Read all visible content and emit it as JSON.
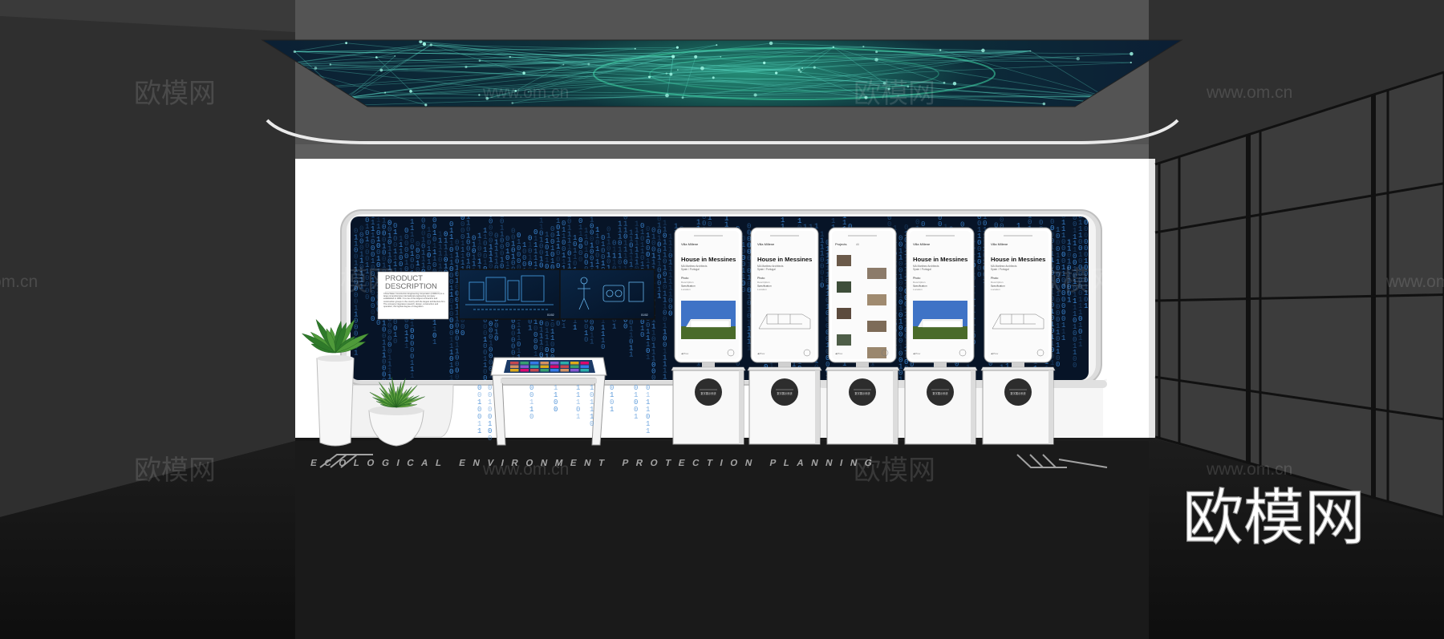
{
  "watermarks": {
    "brand_cn": "欧模网",
    "site": "www.om.cn",
    "site_partial": "om.cn",
    "big_logo": "欧模网"
  },
  "description_panel": {
    "title_line1": "PRODUCT",
    "title_line2": "DESCRIPTION",
    "body": "China Water Construction Engineering Corporation (CWECC) is a large comprehensive international engineering company established in 1982. It is one of the largest contractors and construction groups in the country with the largest architecture firm. The company integrates research, design, construction and operation, the highest degree of integration."
  },
  "screen_panels": {
    "left_caption": "01/02",
    "right_caption": "01/02"
  },
  "kiosks": [
    {
      "type": "house",
      "header": "Villa Millene",
      "title": "House in Messines",
      "sub1": "MA Martinez Architects",
      "sub2": "Spain / Portugal",
      "section": "Photo",
      "items": [
        "Description",
        "Specification",
        "Location"
      ],
      "footer_left": "◀ Prev",
      "footer_right": "Next ▶"
    },
    {
      "type": "house-sketch",
      "header": "Villa Millene",
      "title": "House in Messines",
      "sub1": "MA Martinez Architects",
      "sub2": "Spain / Portugal",
      "section": "Photo",
      "items": [
        "Description",
        "Specification",
        "Location"
      ],
      "footer_left": "◀ Prev",
      "footer_right": "Next ▶"
    },
    {
      "type": "gallery",
      "header": "Projects",
      "tag": "All",
      "footer_left": "◀ Prev",
      "footer_right": "Next ▶"
    },
    {
      "type": "house",
      "header": "Villa Millene",
      "title": "House in Messines",
      "sub1": "MA Martinez Architects",
      "sub2": "Spain / Portugal",
      "section": "Photo",
      "items": [
        "Description",
        "Specification",
        "Location"
      ],
      "footer_left": "◀ Prev",
      "footer_right": "Next ▶"
    },
    {
      "type": "house-sketch",
      "header": "Villa Millene",
      "title": "House in Messines",
      "sub1": "MA Martinez Architects",
      "sub2": "Spain / Portugal",
      "section": "Photo",
      "items": [
        "Description",
        "Specification",
        "Location"
      ],
      "footer_left": "◀ Prev",
      "footer_right": "Next ▶"
    }
  ],
  "stand_label": "数字展示系统",
  "floor_text": "ECOLOGICAL ENVIRONMENT PROTECTION PLANNING",
  "colors": {
    "wall": "#ffffff",
    "matrix_bg": "#061426",
    "matrix_blue": "#3f8fe0",
    "ceiling_green": "#2fd19a",
    "floor": "#141414",
    "side_wall": "#2d2d2d"
  }
}
